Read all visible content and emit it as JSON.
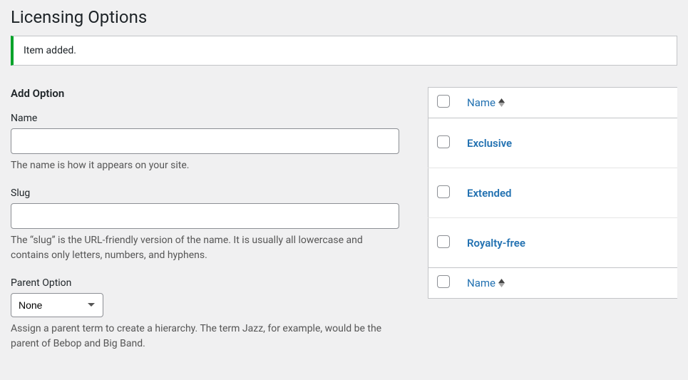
{
  "page": {
    "title": "Licensing Options"
  },
  "notice": {
    "message": "Item added."
  },
  "form": {
    "title": "Add Option",
    "name": {
      "label": "Name",
      "value": "",
      "help": "The name is how it appears on your site."
    },
    "slug": {
      "label": "Slug",
      "value": "",
      "help": "The “slug” is the URL-friendly version of the name. It is usually all lowercase and contains only letters, numbers, and hyphens."
    },
    "parent": {
      "label": "Parent Option",
      "selected": "None",
      "help": "Assign a parent term to create a hierarchy. The term Jazz, for example, would be the parent of Bebop and Big Band."
    }
  },
  "table": {
    "columns": {
      "name": "Name"
    },
    "rows": [
      {
        "name": "Exclusive"
      },
      {
        "name": "Extended"
      },
      {
        "name": "Royalty-free"
      }
    ]
  }
}
